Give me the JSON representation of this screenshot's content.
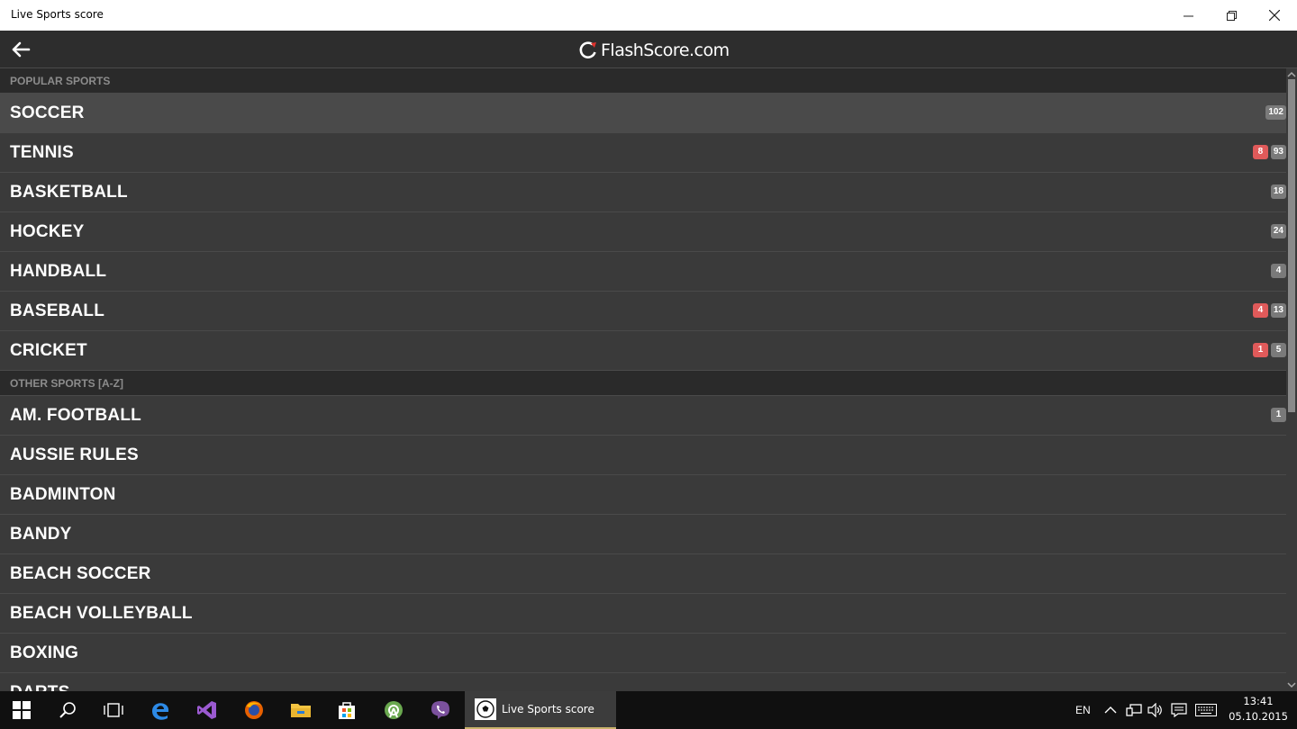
{
  "window": {
    "title": "Live Sports score",
    "minimize_label": "—",
    "restore_label": "❐",
    "close_label": "✕"
  },
  "appbar": {
    "logo_text": "FlashScore.com",
    "back_icon": "arrow-left-icon"
  },
  "sections": [
    {
      "title": "POPULAR SPORTS",
      "items": [
        {
          "name": "SOCCER",
          "live": "",
          "total": "102",
          "selected": true
        },
        {
          "name": "TENNIS",
          "live": "8",
          "total": "93"
        },
        {
          "name": "BASKETBALL",
          "live": "",
          "total": "18"
        },
        {
          "name": "HOCKEY",
          "live": "",
          "total": "24"
        },
        {
          "name": "HANDBALL",
          "live": "",
          "total": "4"
        },
        {
          "name": "BASEBALL",
          "live": "4",
          "total": "13"
        },
        {
          "name": "CRICKET",
          "live": "1",
          "total": "5"
        }
      ]
    },
    {
      "title": "OTHER SPORTS [A-Z]",
      "items": [
        {
          "name": "AM. FOOTBALL",
          "live": "",
          "total": "1"
        },
        {
          "name": "AUSSIE RULES",
          "live": "",
          "total": ""
        },
        {
          "name": "BADMINTON",
          "live": "",
          "total": ""
        },
        {
          "name": "BANDY",
          "live": "",
          "total": ""
        },
        {
          "name": "BEACH SOCCER",
          "live": "",
          "total": ""
        },
        {
          "name": "BEACH VOLLEYBALL",
          "live": "",
          "total": ""
        },
        {
          "name": "BOXING",
          "live": "",
          "total": ""
        },
        {
          "name": "DARTS",
          "live": "",
          "total": ""
        }
      ]
    }
  ],
  "colors": {
    "live_badge": "#e05a5a",
    "count_badge": "#7a7a7a",
    "taskbar_accent": "#c8b26b"
  },
  "taskbar": {
    "active_app_label": "Live Sports score",
    "language": "EN",
    "time": "13:41",
    "date": "05.10.2015"
  }
}
